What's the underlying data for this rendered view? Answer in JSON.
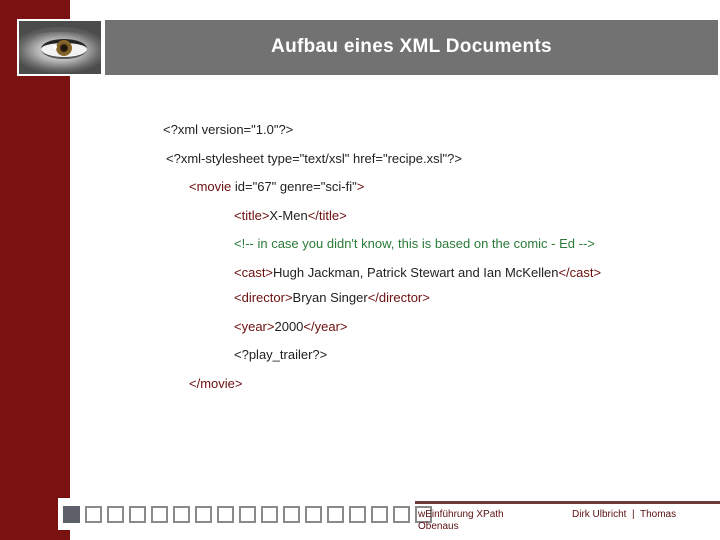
{
  "header": {
    "title": "Aufbau eines XML Documents",
    "logo_icon": "eye-photo"
  },
  "colors": {
    "sidebar": "#7b1212",
    "header_bar": "#727272",
    "tag": "#6b0f0f",
    "comment": "#2a7a38",
    "text": "#222222",
    "footer_text": "#5a1010"
  },
  "code": {
    "lines": [
      {
        "parts": [
          {
            "type": "plain",
            "text": "<?xml version=\"1.0\"?>"
          }
        ]
      },
      {
        "parts": [
          {
            "type": "plain",
            "text": "<?xml-stylesheet type=\"text/xsl\" href=\"recipe.xsl\"?>"
          }
        ]
      },
      {
        "parts": [
          {
            "type": "tag",
            "text": "<movie"
          },
          {
            "type": "plain",
            "text": " id=\"67\" genre=\"sci-fi\""
          },
          {
            "type": "tag",
            "text": ">"
          }
        ]
      },
      {
        "parts": [
          {
            "type": "tag",
            "text": "<title>"
          },
          {
            "type": "plain",
            "text": "X-Men"
          },
          {
            "type": "tag",
            "text": "</title>"
          }
        ]
      },
      {
        "parts": [
          {
            "type": "comment",
            "text": "<!-- in case you didn't know, this is based on the comic - Ed -->"
          }
        ]
      },
      {
        "parts": [
          {
            "type": "tag",
            "text": "<cast>"
          },
          {
            "type": "plain",
            "text": "Hugh Jackman, Patrick Stewart and Ian McKellen"
          },
          {
            "type": "tag",
            "text": "</cast>"
          }
        ]
      },
      {
        "parts": [
          {
            "type": "tag",
            "text": "<director>"
          },
          {
            "type": "plain",
            "text": "Bryan Singer"
          },
          {
            "type": "tag",
            "text": "</director>"
          }
        ]
      },
      {
        "parts": [
          {
            "type": "tag",
            "text": "<year>"
          },
          {
            "type": "plain",
            "text": "2000"
          },
          {
            "type": "tag",
            "text": "</year>"
          }
        ]
      },
      {
        "parts": [
          {
            "type": "plain",
            "text": "<?play_trailer?>"
          }
        ]
      },
      {
        "parts": [
          {
            "type": "tag",
            "text": "</movie>"
          }
        ]
      }
    ]
  },
  "progress": {
    "current": 1,
    "total": 17
  },
  "footer": {
    "left": "wEinführung XPath Obenaus",
    "right": "Dirk Ulbricht  |  Thomas"
  }
}
